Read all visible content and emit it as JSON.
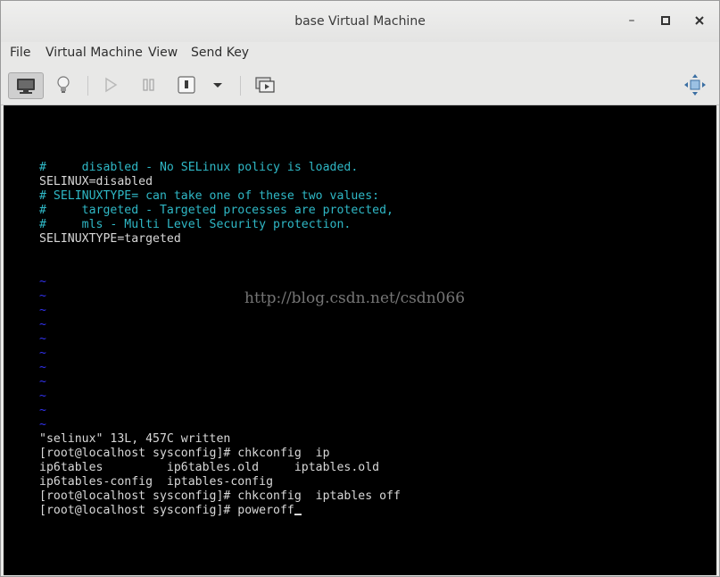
{
  "window": {
    "title": "base Virtual Machine",
    "controls": {
      "minimize": "–",
      "maximize": "□",
      "close": "×"
    }
  },
  "menu": [
    "File",
    "Virtual Machine",
    "View",
    "Send Key"
  ],
  "toolbar": {
    "icons": [
      "monitor-icon",
      "lightbulb-icon",
      "play-icon",
      "pause-icon",
      "power-icon",
      "dropdown-arrow-icon",
      "screenshot-icon",
      "fullscreen-move-icon"
    ]
  },
  "console": {
    "lines": [
      {
        "text": "#     disabled - No SELinux policy is loaded.",
        "color": "cyan"
      },
      {
        "text": "SELINUX=disabled",
        "color": "white"
      },
      {
        "text": "# SELINUXTYPE= can take one of these two values:",
        "color": "cyan"
      },
      {
        "text": "#     targeted - Targeted processes are protected,",
        "color": "cyan"
      },
      {
        "text": "#     mls - Multi Level Security protection.",
        "color": "cyan"
      },
      {
        "text": "SELINUXTYPE=targeted",
        "color": "white"
      },
      {
        "text": "",
        "color": "white"
      },
      {
        "text": "",
        "color": "white"
      },
      {
        "text": "~",
        "color": "tilde"
      },
      {
        "text": "~",
        "color": "tilde"
      },
      {
        "text": "~",
        "color": "tilde"
      },
      {
        "text": "~",
        "color": "tilde"
      },
      {
        "text": "~",
        "color": "tilde"
      },
      {
        "text": "~",
        "color": "tilde"
      },
      {
        "text": "~",
        "color": "tilde"
      },
      {
        "text": "~",
        "color": "tilde"
      },
      {
        "text": "~",
        "color": "tilde"
      },
      {
        "text": "~",
        "color": "tilde"
      },
      {
        "text": "~",
        "color": "tilde"
      },
      {
        "text": "\"selinux\" 13L, 457C written",
        "color": "white"
      },
      {
        "text": "[root@localhost sysconfig]# chkconfig  ip",
        "color": "white"
      },
      {
        "text": "ip6tables         ip6tables.old     iptables.old",
        "color": "white"
      },
      {
        "text": "ip6tables-config  iptables-config",
        "color": "white"
      },
      {
        "text": "[root@localhost sysconfig]# chkconfig  iptables off",
        "color": "white"
      },
      {
        "text": "[root@localhost sysconfig]# poweroff",
        "color": "white"
      }
    ],
    "watermark": "http://blog.csdn.net/csdn066"
  }
}
